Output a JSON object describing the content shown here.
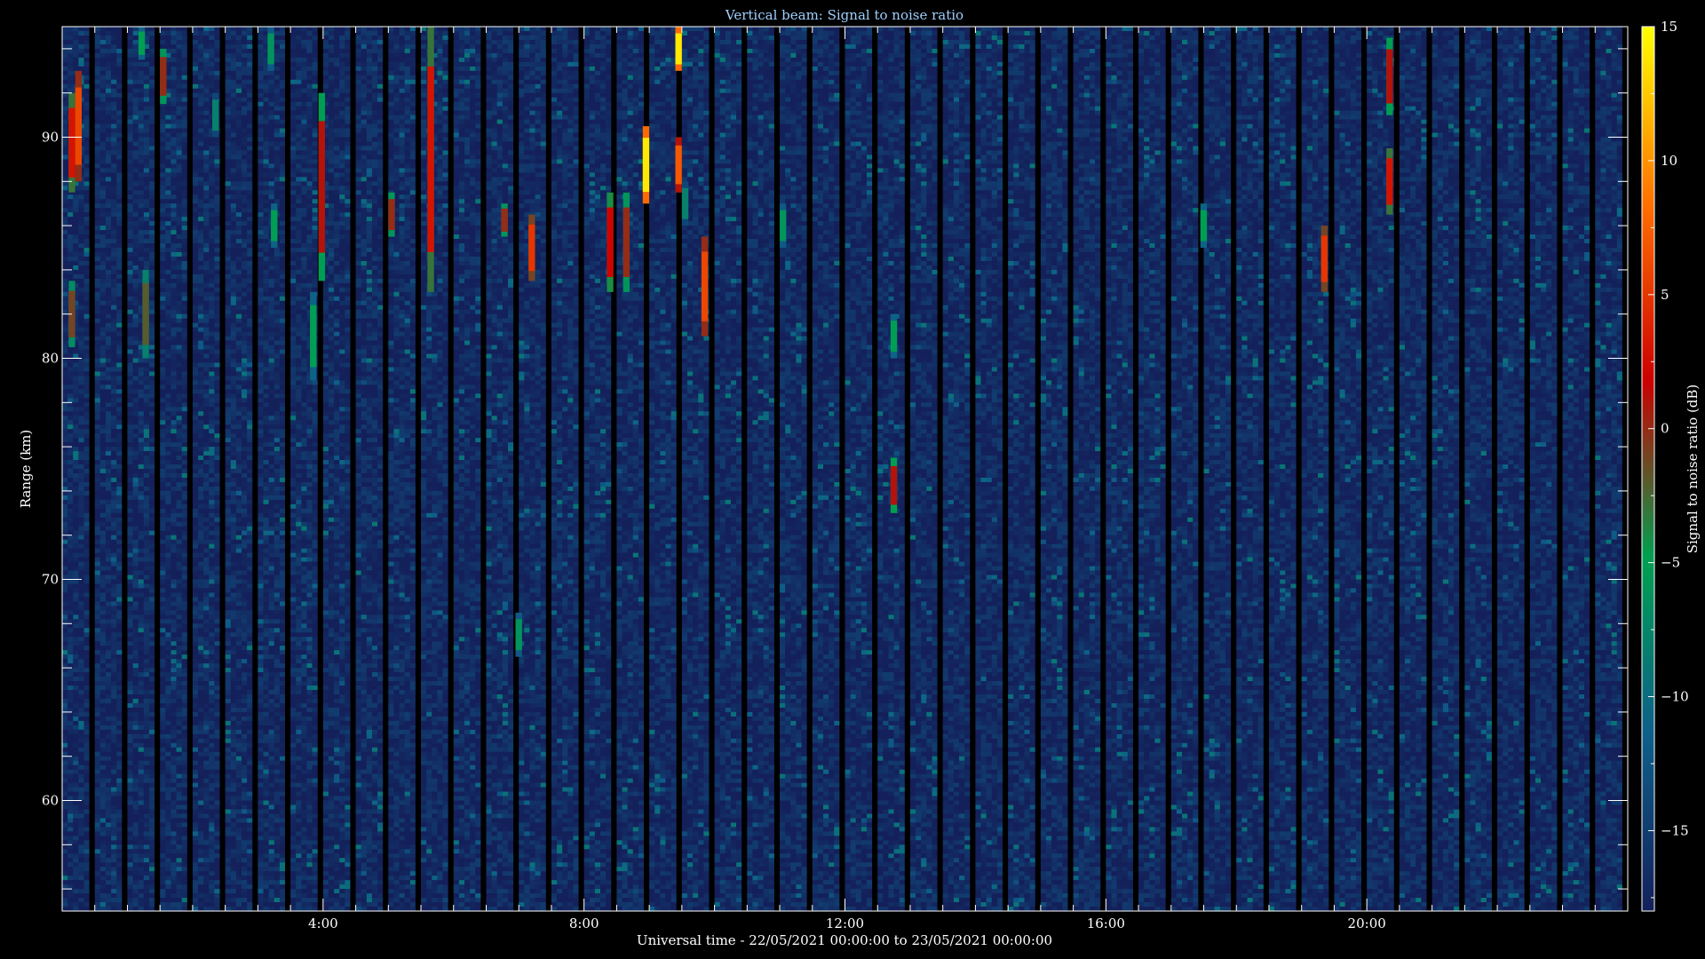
{
  "chart_data": {
    "type": "heatmap",
    "title": "Vertical beam: Signal to noise ratio",
    "xlabel": "Universal time - 22/05/2021 00:00:00 to 23/05/2021 00:00:00",
    "ylabel": "Range (km)",
    "colorbar_label": "Signal to noise ratio (dB)",
    "x_unit": "hours UT",
    "xlim": [
      0,
      24
    ],
    "ylim": [
      55,
      95
    ],
    "x_ticks": [
      4,
      8,
      12,
      16,
      20
    ],
    "x_tick_labels": [
      "4:00",
      "8:00",
      "12:00",
      "16:00",
      "20:00"
    ],
    "y_ticks": [
      60,
      70,
      80,
      90
    ],
    "y_tick_labels": [
      "60",
      "70",
      "80",
      "90"
    ],
    "clim": [
      -18,
      15
    ],
    "colorbar_ticks": [
      15,
      10,
      5,
      0,
      -5,
      -10,
      -15
    ],
    "colorbar_tick_labels": [
      "15",
      "10",
      "5",
      "0",
      "−5",
      "−10",
      "−15"
    ],
    "colormap": [
      "#14205a",
      "#0e5f8a",
      "#00a050",
      "#cc0000",
      "#ff7000",
      "#ffff00"
    ],
    "background_color": "#0a1a55",
    "echoes": [
      {
        "t": 0.15,
        "r0": 87.5,
        "r1": 92,
        "snr": 3
      },
      {
        "t": 0.15,
        "r0": 80.5,
        "r1": 83.5,
        "snr": -1
      },
      {
        "t": 0.25,
        "r0": 88,
        "r1": 93,
        "snr": 6
      },
      {
        "t": 1.22,
        "r0": 93.5,
        "r1": 95,
        "snr": -5
      },
      {
        "t": 1.28,
        "r0": 80,
        "r1": 84,
        "snr": -2
      },
      {
        "t": 1.55,
        "r0": 91.5,
        "r1": 94,
        "snr": 0
      },
      {
        "t": 2.35,
        "r0": 90,
        "r1": 92,
        "snr": -8
      },
      {
        "t": 3.2,
        "r0": 93,
        "r1": 95,
        "snr": -6
      },
      {
        "t": 3.25,
        "r0": 85,
        "r1": 87,
        "snr": -5
      },
      {
        "t": 3.85,
        "r0": 79,
        "r1": 83,
        "snr": -5
      },
      {
        "t": 3.98,
        "r0": 83.5,
        "r1": 92,
        "snr": 1
      },
      {
        "t": 5.05,
        "r0": 85.5,
        "r1": 87.5,
        "snr": 0
      },
      {
        "t": 5.65,
        "r0": 83,
        "r1": 95,
        "snr": 3
      },
      {
        "t": 6.78,
        "r0": 85.5,
        "r1": 87,
        "snr": 0
      },
      {
        "t": 7.0,
        "r0": 66.5,
        "r1": 68.5,
        "snr": -6
      },
      {
        "t": 7.2,
        "r0": 83.5,
        "r1": 86.5,
        "snr": 5
      },
      {
        "t": 8.4,
        "r0": 83,
        "r1": 87.5,
        "snr": 2
      },
      {
        "t": 8.65,
        "r0": 83,
        "r1": 87.5,
        "snr": 0
      },
      {
        "t": 8.95,
        "r0": 87,
        "r1": 90.5,
        "snr": 14
      },
      {
        "t": 9.45,
        "r0": 93,
        "r1": 95,
        "snr": 14
      },
      {
        "t": 9.45,
        "r0": 87.5,
        "r1": 90,
        "snr": 7
      },
      {
        "t": 9.55,
        "r0": 86,
        "r1": 88,
        "snr": -8
      },
      {
        "t": 9.85,
        "r0": 81,
        "r1": 85.5,
        "snr": 6
      },
      {
        "t": 11.05,
        "r0": 85,
        "r1": 87,
        "snr": -6
      },
      {
        "t": 12.75,
        "r0": 73,
        "r1": 75.5,
        "snr": 1
      },
      {
        "t": 12.75,
        "r0": 80,
        "r1": 82,
        "snr": -5
      },
      {
        "t": 17.5,
        "r0": 85,
        "r1": 87,
        "snr": -5
      },
      {
        "t": 19.35,
        "r0": 83,
        "r1": 86,
        "snr": 5
      },
      {
        "t": 20.35,
        "r0": 91,
        "r1": 94.5,
        "snr": 1
      },
      {
        "t": 20.35,
        "r0": 86.5,
        "r1": 89.5,
        "snr": 3
      }
    ]
  }
}
